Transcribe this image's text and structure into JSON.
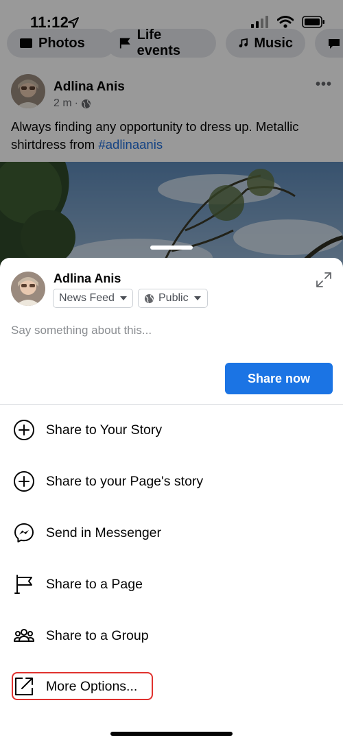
{
  "status_bar": {
    "time": "11:12",
    "icons": [
      "location-arrow-icon",
      "signal-bars-icon",
      "wifi-icon",
      "battery-icon"
    ]
  },
  "filter_chips": [
    {
      "label": "Photos",
      "icon": "photo-icon"
    },
    {
      "label": "Life events",
      "icon": "flag-icon"
    },
    {
      "label": "Music",
      "icon": "music-note-icon"
    }
  ],
  "post": {
    "author": "Adlina Anis",
    "time": "2 m",
    "separator": "·",
    "audience_icon": "globe-icon",
    "text": "Always finding any opportunity to dress up. Metallic shirtdress from ",
    "hashtag": "#adlinaanis",
    "more_icon": "ellipsis-icon"
  },
  "share_sheet": {
    "author": "Adlina Anis",
    "destination_select": "News Feed",
    "audience_select": "Public",
    "input_placeholder": "Say something about this...",
    "share_now_label": "Share now",
    "options": [
      {
        "label": "Share to Your Story",
        "icon": "plus-circle-icon"
      },
      {
        "label": "Share to your Page's story",
        "icon": "plus-circle-icon"
      },
      {
        "label": "Send in Messenger",
        "icon": "messenger-icon"
      },
      {
        "label": "Share to a Page",
        "icon": "page-flag-icon"
      },
      {
        "label": "Share to a Group",
        "icon": "group-icon"
      },
      {
        "label": "More Options...",
        "icon": "external-share-icon"
      }
    ]
  },
  "colors": {
    "primary_button": "#1b74e4",
    "hashtag": "#216fdb",
    "highlight": "#e0312e",
    "secondary_text": "#65676b"
  }
}
